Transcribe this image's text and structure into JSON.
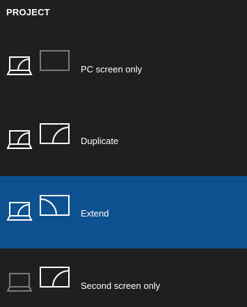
{
  "panel": {
    "title": "PROJECT"
  },
  "options": [
    {
      "label": "PC screen only",
      "icon": "pc-screen-only-icon",
      "selected": false
    },
    {
      "label": "Duplicate",
      "icon": "duplicate-icon",
      "selected": false
    },
    {
      "label": "Extend",
      "icon": "extend-icon",
      "selected": true
    },
    {
      "label": "Second screen only",
      "icon": "second-screen-only-icon",
      "selected": false
    }
  ],
  "colors": {
    "background": "#1f1f1f",
    "selected_background": "#0e5190",
    "active_stroke": "#ffffff",
    "inactive_stroke": "#7a7a7a"
  }
}
